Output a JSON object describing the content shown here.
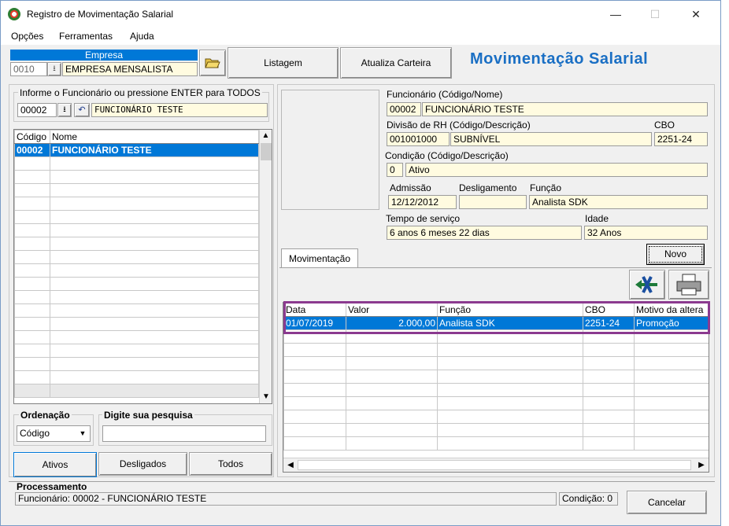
{
  "window": {
    "title": "Registro de Movimentação Salarial",
    "minimize": "—",
    "maximize": "☐",
    "close": "✕"
  },
  "menu": [
    {
      "label": "Opções"
    },
    {
      "label": "Ferramentas"
    },
    {
      "label": "Ajuda"
    }
  ],
  "empresa": {
    "label": "Empresa",
    "code": "0010",
    "name": "EMPRESA MENSALISTA"
  },
  "toolbar": {
    "listagem": "Listagem",
    "atualiza": "Atualiza Carteira"
  },
  "page_title": "Movimentação  Salarial",
  "search_employee": {
    "legend": "Informe o Funcionário ou pressione ENTER para TODOS",
    "code": "00002",
    "name": "FUNCIONÁRIO TESTE"
  },
  "employee_list": {
    "columns": [
      "Código",
      "Nome"
    ],
    "rows": [
      [
        "00002",
        "FUNCIONÁRIO TESTE"
      ]
    ]
  },
  "ordering": {
    "label": "Ordenação",
    "value": "Código"
  },
  "search": {
    "label": "Digite sua pesquisa",
    "value": ""
  },
  "filter_buttons": {
    "ativos": "Ativos",
    "desligados": "Desligados",
    "todos": "Todos"
  },
  "details": {
    "funcionario_label": "Funcionário (Código/Nome)",
    "funcionario_code": "00002",
    "funcionario_name": "FUNCIONÁRIO TESTE",
    "divisao_label": "Divisão de RH (Código/Descrição)",
    "divisao_code": "001001000",
    "divisao_desc": "SUBNÍVEL",
    "cbo_label": "CBO",
    "cbo": "2251-24",
    "condicao_label": "Condição (Código/Descrição)",
    "condicao_code": "0",
    "condicao_desc": "Ativo",
    "admissao_label": "Admissão",
    "admissao": "12/12/2012",
    "desligamento_label": "Desligamento",
    "desligamento": "",
    "funcao_label": "Função",
    "funcao": "Analista SDK",
    "tempo_label": "Tempo de serviço",
    "tempo": "6 anos 6 meses 22 dias",
    "idade_label": "Idade",
    "idade": "32 Anos"
  },
  "tab": {
    "label": "Movimentação"
  },
  "novo_button": "Novo",
  "movements": {
    "columns": [
      "Data",
      "Valor",
      "Função",
      "CBO",
      "Motivo da altera"
    ],
    "rows": [
      [
        "01/07/2019",
        "2.000,00",
        "Analista SDK",
        "2251-24",
        "Promoção"
      ]
    ]
  },
  "processing": {
    "label": "Processamento",
    "status": "Funcionário: 00002 - FUNCIONÁRIO TESTE",
    "condicao": "Condição: 0"
  },
  "cancel_button": "Cancelar",
  "colors": {
    "accent": "#0078d7",
    "title_blue": "#1a6fc4",
    "field_bg": "#fffbe0",
    "highlight_border": "#8b3a8f"
  }
}
